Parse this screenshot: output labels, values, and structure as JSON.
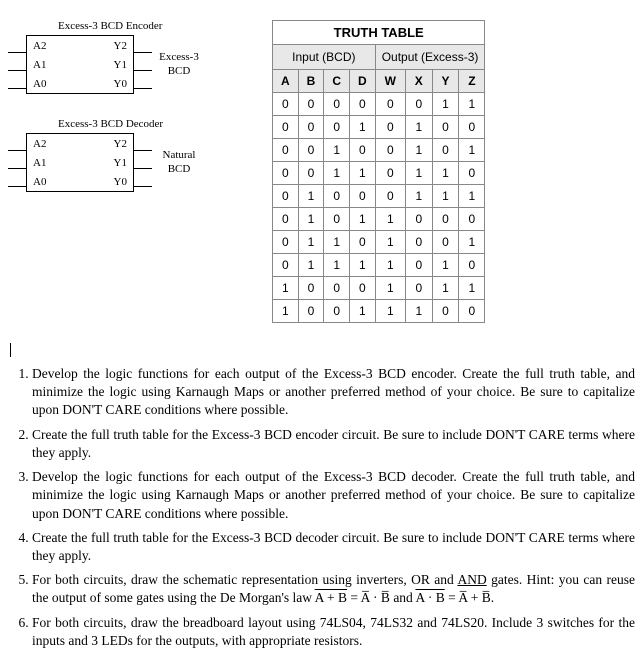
{
  "diagrams": {
    "encoder": {
      "title": "Excess-3 BCD Encoder",
      "left": [
        "A2",
        "A1",
        "A0"
      ],
      "right": [
        "Y2",
        "Y1",
        "Y0"
      ],
      "side_label_top": "Excess-3",
      "side_label_bot": "BCD"
    },
    "decoder": {
      "title": "Excess-3 BCD Decoder",
      "left": [
        "A2",
        "A1",
        "A0"
      ],
      "right": [
        "Y2",
        "Y1",
        "Y0"
      ],
      "side_label_top": "Natural",
      "side_label_bot": "BCD"
    }
  },
  "truth_table": {
    "title": "TRUTH TABLE",
    "group_left": "Input (BCD)",
    "group_right": "Output (Excess-3)",
    "cols_left": [
      "A",
      "B",
      "C",
      "D"
    ],
    "cols_right": [
      "W",
      "X",
      "Y",
      "Z"
    ],
    "rows": [
      {
        "in": [
          "0",
          "0",
          "0",
          "0"
        ],
        "out": [
          "0",
          "0",
          "1",
          "1"
        ]
      },
      {
        "in": [
          "0",
          "0",
          "0",
          "1"
        ],
        "out": [
          "0",
          "1",
          "0",
          "0"
        ]
      },
      {
        "in": [
          "0",
          "0",
          "1",
          "0"
        ],
        "out": [
          "0",
          "1",
          "0",
          "1"
        ]
      },
      {
        "in": [
          "0",
          "0",
          "1",
          "1"
        ],
        "out": [
          "0",
          "1",
          "1",
          "0"
        ]
      },
      {
        "in": [
          "0",
          "1",
          "0",
          "0"
        ],
        "out": [
          "0",
          "1",
          "1",
          "1"
        ]
      },
      {
        "in": [
          "0",
          "1",
          "0",
          "1"
        ],
        "out": [
          "1",
          "0",
          "0",
          "0"
        ]
      },
      {
        "in": [
          "0",
          "1",
          "1",
          "0"
        ],
        "out": [
          "1",
          "0",
          "0",
          "1"
        ]
      },
      {
        "in": [
          "0",
          "1",
          "1",
          "1"
        ],
        "out": [
          "1",
          "0",
          "1",
          "0"
        ]
      },
      {
        "in": [
          "1",
          "0",
          "0",
          "0"
        ],
        "out": [
          "1",
          "0",
          "1",
          "1"
        ]
      },
      {
        "in": [
          "1",
          "0",
          "0",
          "1"
        ],
        "out": [
          "1",
          "1",
          "0",
          "0"
        ]
      }
    ]
  },
  "questions": {
    "q1": "Develop the logic functions for each output of the Excess-3 BCD encoder. Create the full truth table, and minimize the logic using Karnaugh Maps or another preferred method of your choice. Be sure to capitalize upon DON'T CARE conditions where possible.",
    "q2": "Create the full truth table for the Excess-3 BCD encoder circuit. Be sure to include DON'T CARE terms where they apply.",
    "q3": "Develop the logic functions for each output of the Excess-3 BCD decoder. Create the full truth table, and minimize the logic using Karnaugh Maps or another preferred method of your choice. Be sure to capitalize upon DON'T CARE conditions where possible.",
    "q4": "Create the full truth table for the Excess-3 BCD decoder circuit. Be sure to include DON'T CARE terms where they apply.",
    "q5_pre": "For both circuits, draw the schematic representation using inverters, OR and ",
    "q5_and": "AND",
    "q5_mid": " gates. Hint: you can reuse the output of some gates using the De Morgan's law ",
    "q5_eqa_lhs": "A + B",
    "q5_eqa_eq": " = ",
    "q5_eqa_r1": "A̅",
    "q5_eqa_dot": " · ",
    "q5_eqa_r2": "B̅",
    "q5_and2": " and ",
    "q5_eqb_lhs": "A · B",
    "q5_eqb_eq": " = ",
    "q5_eqb_r1": "A̅",
    "q5_eqb_plus": " + ",
    "q5_eqb_r2": "B̅",
    "q5_end": ".",
    "q6": "For both circuits, draw the breadboard layout using 74LS04, 74LS32 and 74LS20. Include 3 switches for the inputs and 3 LEDs for the outputs, with appropriate resistors."
  }
}
